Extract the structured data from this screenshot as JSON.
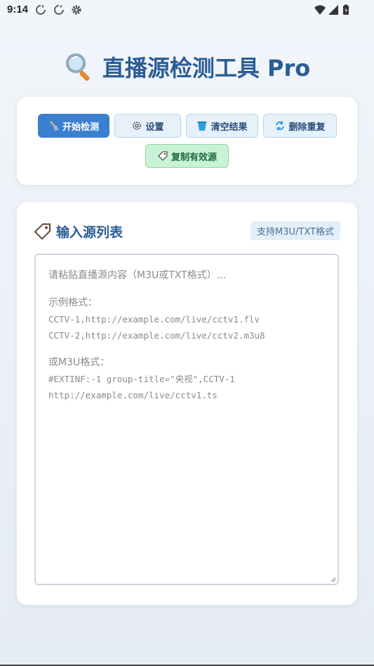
{
  "status": {
    "time": "9:14"
  },
  "header": {
    "title": "直播源检测工具 Pro"
  },
  "buttons": {
    "start": "开始检测",
    "settings": "设置",
    "clear": "清空结果",
    "dedupe": "删除重复",
    "copy_valid": "复制有效源"
  },
  "input_section": {
    "title": "输入源列表",
    "badge": "支持M3U/TXT格式",
    "placeholder": {
      "line1": "请粘贴直播源内容（M3U或TXT格式）...",
      "example_label": "示例格式：",
      "example1": "CCTV-1,http://example.com/live/cctv1.flv",
      "example2": "CCTV-2,http://example.com/live/cctv2.m3u8",
      "m3u_label": "或M3U格式：",
      "m3u1": "#EXTINF:-1 group-title=\"央视\",CCTV-1",
      "m3u2": "http://example.com/live/cctv1.ts"
    }
  },
  "colors": {
    "accent": "#3a7fd0",
    "title": "#2a5d95",
    "success_bg": "#c9f1d6"
  }
}
